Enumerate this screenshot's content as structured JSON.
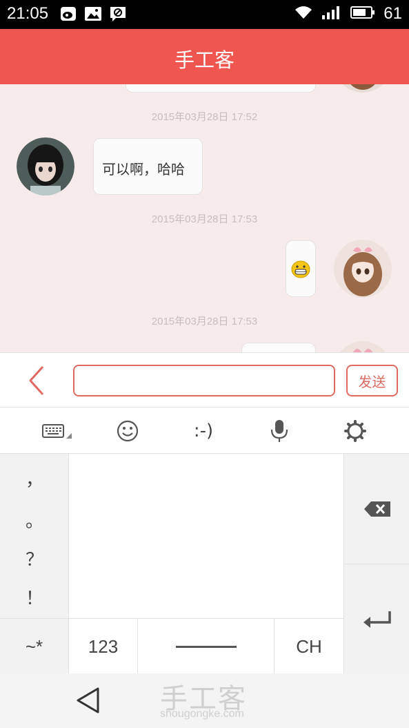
{
  "status_bar": {
    "time": "21:05",
    "battery_level": "61",
    "icons": [
      "weibo-icon",
      "image-icon",
      "blocked-message-icon",
      "wifi-icon",
      "signal-icon",
      "battery-icon"
    ]
  },
  "header": {
    "title": "手工客",
    "background_color": "#ef5650"
  },
  "chat": {
    "messages": [
      {
        "type": "timestamp",
        "text": "2015年03月28日 17:52"
      },
      {
        "type": "received",
        "text": "可以啊，哈哈"
      },
      {
        "type": "timestamp",
        "text": "2015年03月28日 17:53"
      },
      {
        "type": "sent",
        "content": "grinning-emoji-icon"
      },
      {
        "type": "timestamp",
        "text": "2015年03月28日 17:53"
      }
    ]
  },
  "input_bar": {
    "value": "",
    "placeholder": "",
    "send_label": "发送",
    "accent_color": "#e06a63"
  },
  "ime_toolbar": {
    "tools": [
      "keyboard-icon",
      "smiley-icon",
      "emoticon",
      "microphone-icon",
      "settings-icon"
    ],
    "emoticon_text": ":-)"
  },
  "keyboard": {
    "punctuation": [
      "，",
      "。",
      "？",
      "！"
    ],
    "symbols_label": "~*",
    "numbers_label": "123",
    "language_label": "CH"
  },
  "watermark": {
    "logo": "手工客",
    "url": "shougongke.com"
  }
}
